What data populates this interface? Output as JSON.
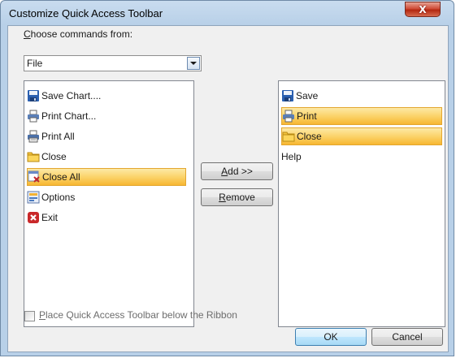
{
  "window": {
    "title": "Customize Quick Access Toolbar",
    "close_glyph": "X"
  },
  "choose": {
    "label_accel": "C",
    "label_rest": "hoose commands from:",
    "selected": "File"
  },
  "available_commands": [
    {
      "label": "Save Chart....",
      "icon": "save-icon",
      "selected": false
    },
    {
      "label": "Print Chart...",
      "icon": "print-icon",
      "selected": false
    },
    {
      "label": "Print All",
      "icon": "print-all-icon",
      "selected": false
    },
    {
      "label": "Close",
      "icon": "folder-icon",
      "selected": false
    },
    {
      "label": "Close All",
      "icon": "close-all-icon",
      "selected": true
    },
    {
      "label": "Options",
      "icon": "options-icon",
      "selected": false
    },
    {
      "label": "Exit",
      "icon": "exit-icon",
      "selected": false
    }
  ],
  "toolbar_commands": [
    {
      "label": "Save",
      "icon": "save-icon",
      "selected": false
    },
    {
      "label": "Print",
      "icon": "print-icon",
      "selected": true
    },
    {
      "label": "Close",
      "icon": "folder-icon",
      "selected": true
    },
    {
      "label": "Help",
      "icon": "",
      "selected": false
    }
  ],
  "buttons": {
    "add_accel": "A",
    "add_rest": "dd >>",
    "remove_accel": "R",
    "remove_rest": "emove",
    "ok": "OK",
    "cancel": "Cancel"
  },
  "checkbox": {
    "label_accel": "P",
    "label_rest": "lace Quick Access Toolbar below the Ribbon",
    "checked": false
  },
  "colors": {
    "selection": "#fbd36a",
    "title_gradient": "#c9dcef",
    "close_red": "#cf4d38"
  }
}
